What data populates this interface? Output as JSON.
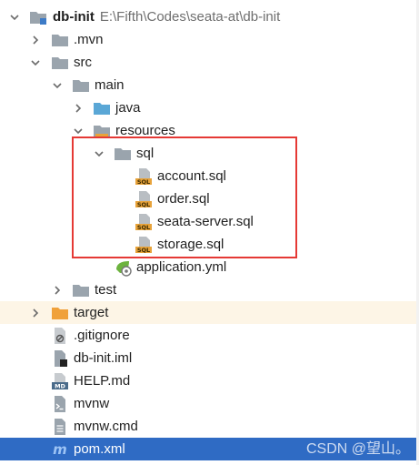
{
  "tree": {
    "root": {
      "name": "db-init",
      "path": "E:\\Fifth\\Codes\\seata-at\\db-init"
    },
    "items": [
      {
        "label": ".mvn"
      },
      {
        "label": "src"
      },
      {
        "label": "main"
      },
      {
        "label": "java"
      },
      {
        "label": "resources"
      },
      {
        "label": "sql"
      },
      {
        "label": "account.sql"
      },
      {
        "label": "order.sql"
      },
      {
        "label": "seata-server.sql"
      },
      {
        "label": "storage.sql"
      },
      {
        "label": "application.yml"
      },
      {
        "label": "test"
      },
      {
        "label": "target"
      },
      {
        "label": ".gitignore"
      },
      {
        "label": "db-init.iml"
      },
      {
        "label": "HELP.md"
      },
      {
        "label": "mvnw"
      },
      {
        "label": "mvnw.cmd"
      },
      {
        "label": "pom.xml"
      }
    ]
  },
  "watermark": "CSDN @望山。",
  "colors": {
    "folder_grey": "#9aa4ad",
    "folder_blue": "#5aa7d6",
    "folder_orange": "#f0a13a",
    "selection_blue": "#2f6bc4",
    "highlight_box": "#e53935",
    "sql_badge": "#e8a33a"
  }
}
